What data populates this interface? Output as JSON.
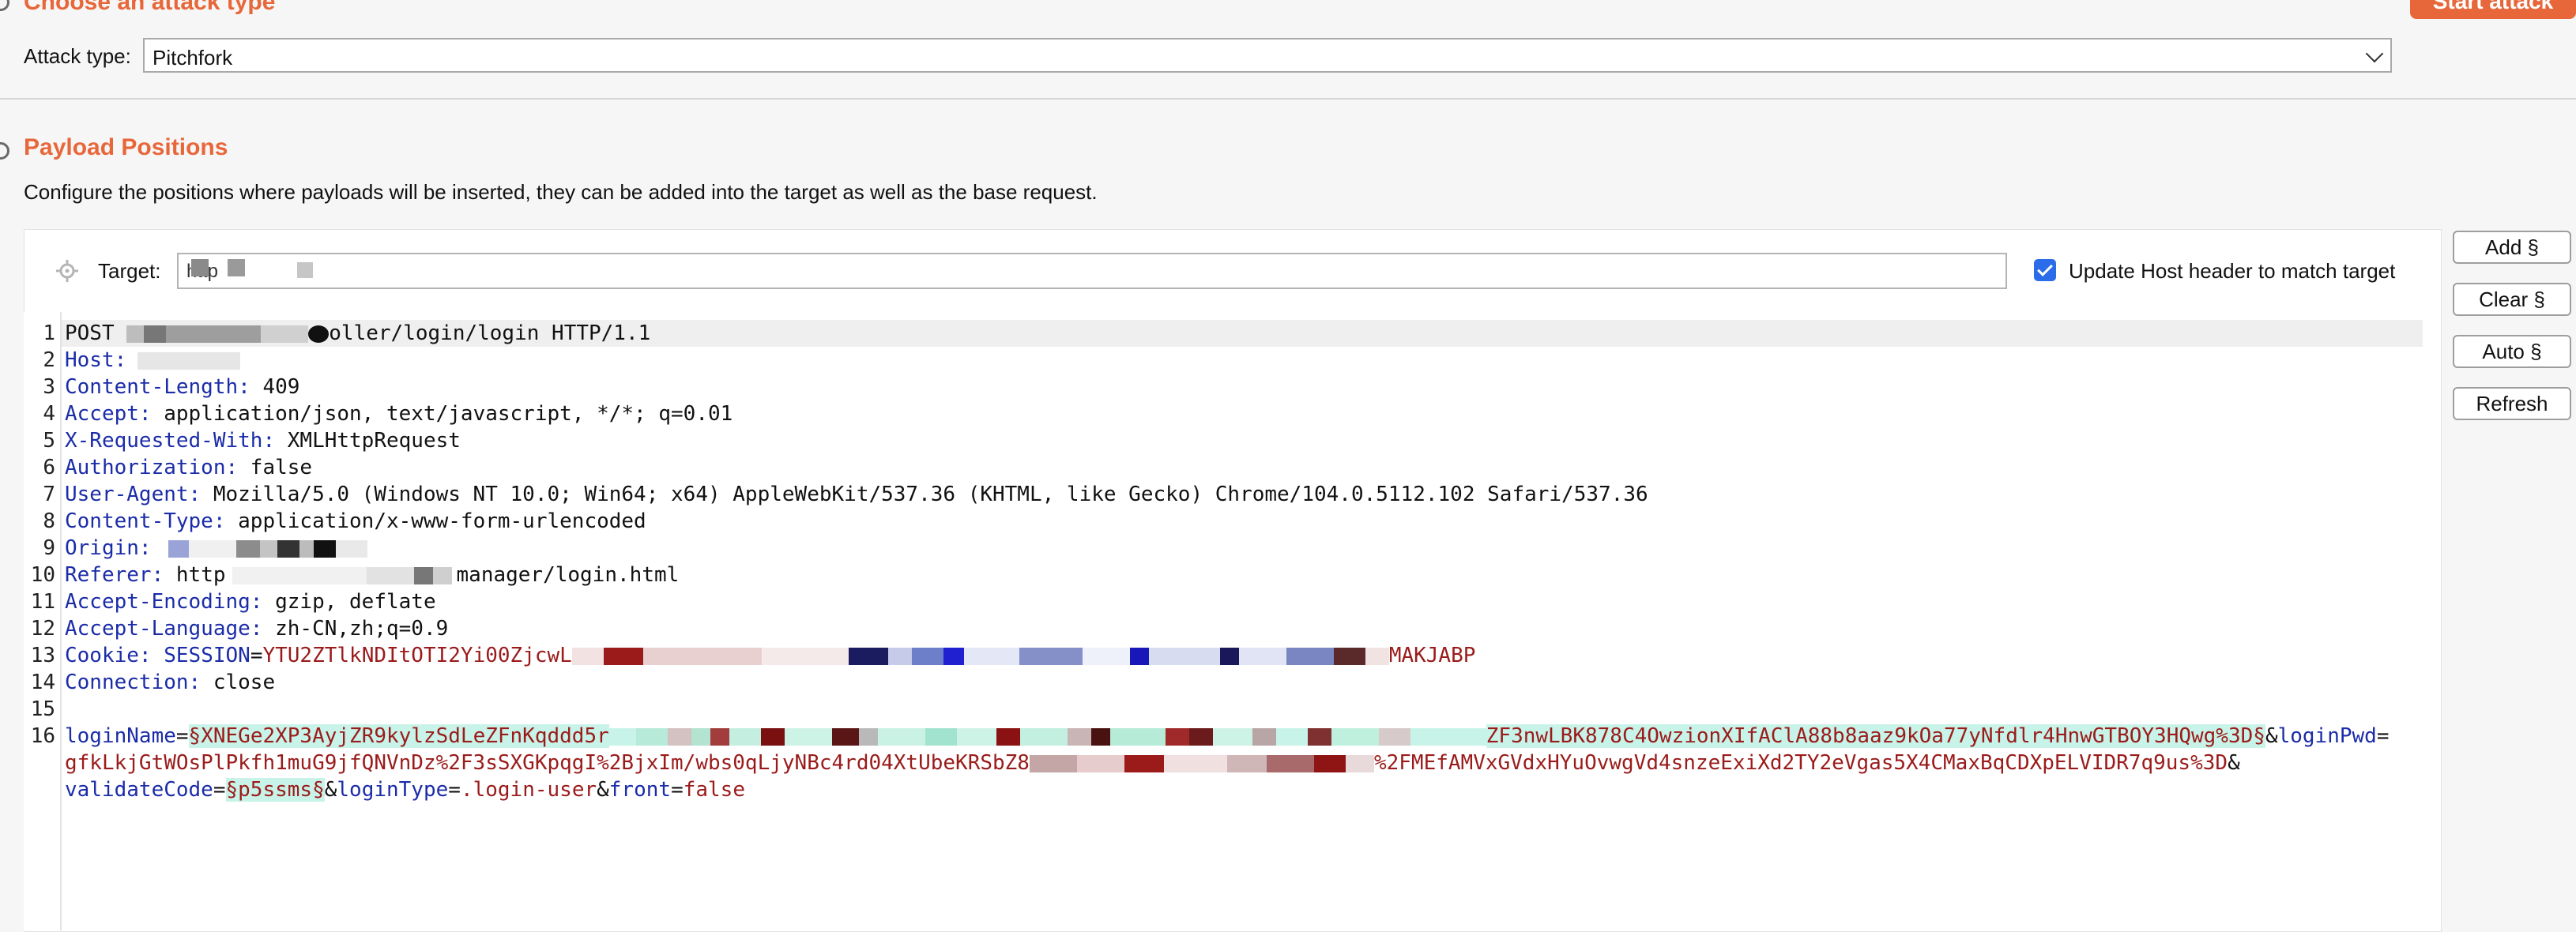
{
  "attack_section": {
    "title": "Choose an attack type",
    "start_button": "Start attack",
    "attack_type_label": "Attack type:",
    "attack_type_value": "Pitchfork"
  },
  "payload_section": {
    "title": "Payload Positions",
    "description": "Configure the positions where payloads will be inserted, they can be added into the target as well as the base request.",
    "target_label": "Target:",
    "target_value": "http",
    "update_host_label": "Update Host header to match target",
    "update_host_checked": true,
    "buttons": {
      "add": "Add §",
      "clear": "Clear §",
      "auto": "Auto §",
      "refresh": "Refresh"
    }
  },
  "request": {
    "line_numbers": [
      "1",
      "2",
      "3",
      "4",
      "5",
      "6",
      "7",
      "8",
      "9",
      "10",
      "11",
      "12",
      "13",
      "14",
      "15",
      "16"
    ],
    "l1_method": "POST",
    "l1_rest": "oller/login/login HTTP/1.1",
    "l2_name": "Host:",
    "l2_val": "",
    "l3_name": "Content-Length:",
    "l3_val": " 409",
    "l4_name": "Accept:",
    "l4_val": " application/json, text/javascript, */*; q=0.01",
    "l5_name": "X-Requested-With:",
    "l5_val": " XMLHttpRequest",
    "l6_name": "Authorization:",
    "l6_val": " false",
    "l7_name": "User-Agent:",
    "l7_val": " Mozilla/5.0 (Windows NT 10.0; Win64; x64) AppleWebKit/537.36 (KHTML, like Gecko) Chrome/104.0.5112.102 Safari/537.36",
    "l8_name": "Content-Type:",
    "l8_val": " application/x-www-form-urlencoded",
    "l9_name": "Origin:",
    "l9_val": " ",
    "l10_name": "Referer:",
    "l10_val": " http",
    "l10_tail": "manager/login.html",
    "l11_name": "Accept-Encoding:",
    "l11_val": " gzip, deflate",
    "l12_name": "Accept-Language:",
    "l12_val": " zh-CN,zh;q=0.9",
    "l13_name": "Cookie:",
    "l13_cookie_name": " SESSION",
    "l13_eq": "=",
    "l13_cookie_val": "YTU2ZTlkNDItOTI2Yi00ZjcwL",
    "l13_tail": "MAKJABP",
    "l14_name": "Connection:",
    "l14_val": " close",
    "l16_p1": "loginName",
    "l16_p1_val": "§XNEGe2XP3AyjZR9kylzSdLeZFnKqddd5r",
    "l16_p1_tail": "ZF3nwLBK878C4OwzionXIfAClA88b8aaz9kOa77yNfdlr4HnwGTBOY3HQwg%3D§",
    "l16_amp1": "&",
    "l16_p2": "loginPwd",
    "l16_eq": "=",
    "l16_p2_val": "gfkLkjGtWOsPlPkfh1muG9jfQNVnDz%2F3sSXGKpqgI%2BjxIm/wbs0qLjyNBc4rd04XtUbeKRSbZ8",
    "l16_p2_tail": "%2FMEfAMVxGVdxHYuOvwgVd4snzeExiXd2TY2eVgas5X4CMaxBqCDXpELVIDR7q9us%3D",
    "l16_amp2": "&",
    "l16_p3": "validateCode",
    "l16_p3_val": "§p5ssms§",
    "l16_amp3": "&",
    "l16_p4": "loginType",
    "l16_p4_val": ".login-user",
    "l16_amp4": "&",
    "l16_p5": "front",
    "l16_p5_val": "false"
  }
}
